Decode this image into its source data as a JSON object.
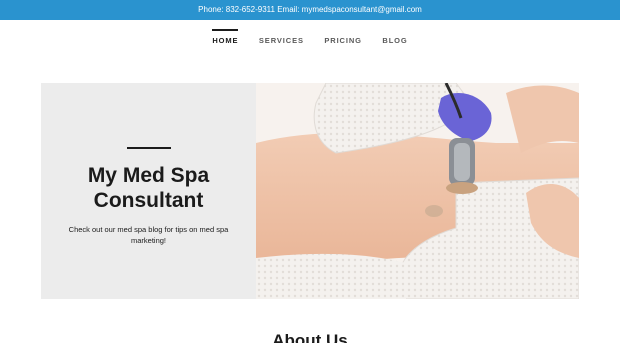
{
  "topbar": {
    "contact": "Phone: 832-652-9311 Email: mymedspaconsultant@gmail.com"
  },
  "nav": {
    "items": [
      {
        "label": "HOME",
        "active": true
      },
      {
        "label": "SERVICES",
        "active": false
      },
      {
        "label": "PRICING",
        "active": false
      },
      {
        "label": "BLOG",
        "active": false
      }
    ]
  },
  "hero": {
    "title": "My Med Spa Consultant",
    "subtitle": "Check out our med spa blog for tips on med spa marketing!"
  },
  "about": {
    "heading": "About Us"
  },
  "colors": {
    "topbar": "#2a93cf",
    "hero_panel": "#ececec",
    "text": "#1b1b1b",
    "glove": "#6a64d6"
  },
  "icons": [
    "none"
  ]
}
